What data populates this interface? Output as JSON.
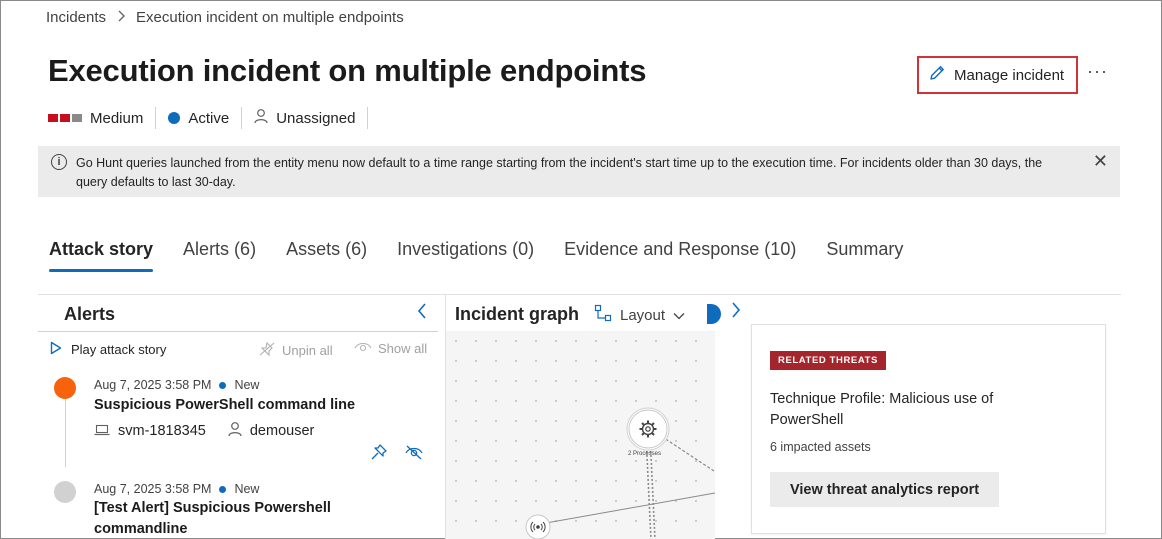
{
  "breadcrumb": {
    "root": "Incidents",
    "separator_icon": "chevron-right-icon",
    "current": "Execution incident on multiple endpoints"
  },
  "header": {
    "title": "Execution incident on multiple endpoints",
    "manage_label": "Manage incident",
    "more_label": "···"
  },
  "status": {
    "severity": "Medium",
    "severity_colors": [
      "#c50f1f",
      "#c50f1f",
      "#8a8a8a"
    ],
    "state": "Active",
    "assignee": "Unassigned"
  },
  "banner": {
    "text": "Go Hunt queries launched from the entity menu now default to a time range starting from the incident's start time up to the execution time. For incidents older than 30 days, the query defaults to last 30-day.",
    "info_glyph": "i",
    "close_glyph": "✕"
  },
  "tabs": [
    {
      "label": "Attack story",
      "active": true
    },
    {
      "label": "Alerts (6)"
    },
    {
      "label": "Assets (6)"
    },
    {
      "label": "Investigations (0)"
    },
    {
      "label": "Evidence and Response (10)"
    },
    {
      "label": "Summary"
    }
  ],
  "alerts_panel": {
    "heading": "Alerts",
    "play_label": "Play attack story",
    "unpin_label": "Unpin all",
    "show_all_label": "Show all",
    "items": [
      {
        "timestamp": "Aug 7, 2025 3:58 PM",
        "status": "New",
        "title": "Suspicious PowerShell command line",
        "device": "svm-1818345",
        "user": "demouser",
        "dot_color": "#f7630c"
      },
      {
        "timestamp": "Aug 7, 2025 3:58 PM",
        "status": "New",
        "title": "[Test Alert] Suspicious Powershell commandline",
        "dot_color": "#d1d1d1"
      }
    ]
  },
  "graph_panel": {
    "heading": "Incident graph",
    "layout_label": "Layout",
    "node_label": "2 Processes"
  },
  "threat_card": {
    "badge": "RELATED THREATS",
    "title": "Technique Profile: Malicious use of PowerShell",
    "impacted": "6 impacted assets",
    "button_label": "View threat analytics report"
  }
}
